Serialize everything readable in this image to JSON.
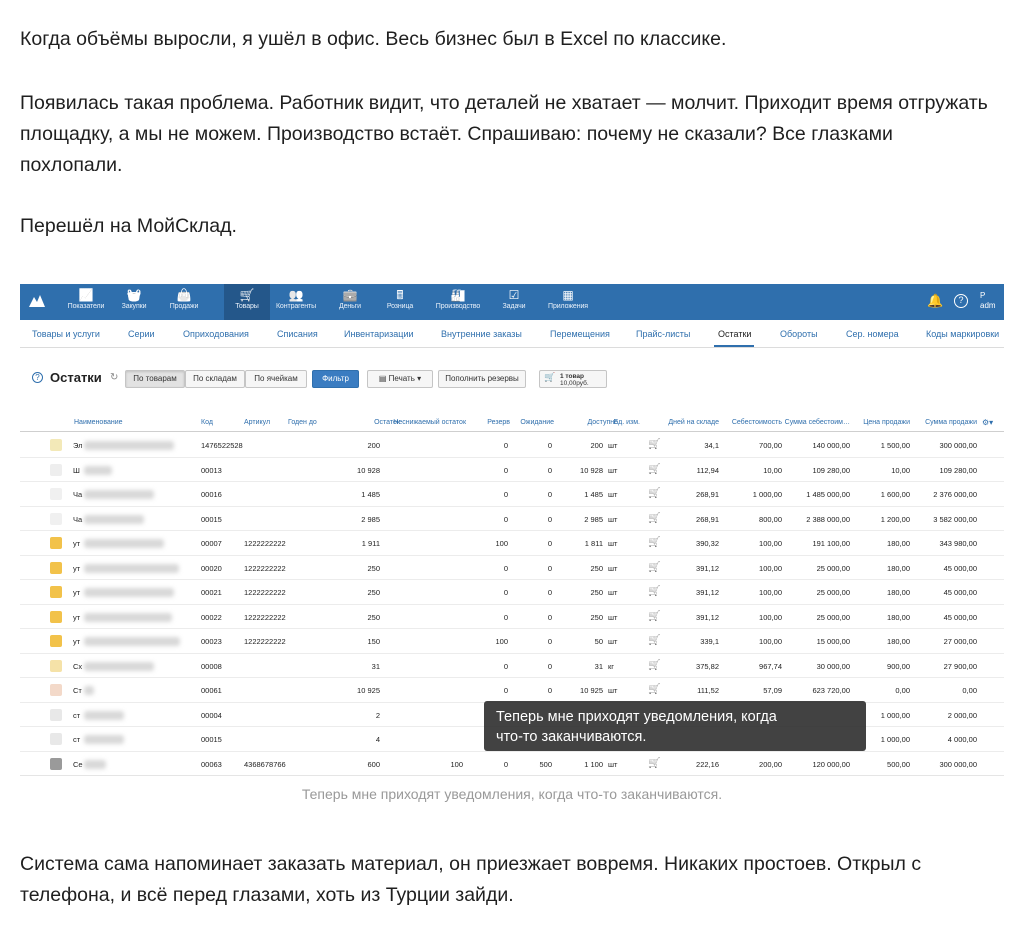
{
  "article": {
    "p1": "Когда объёмы выросли, я ушёл в офис. Весь бизнес был в Excel по классике.",
    "p2": "Появилась такая проблема. Работник видит, что деталей не хватает — молчит. Приходит время отгружать площадку, а мы не можем. Производство встаёт. Спрашиваю: почему не сказали? Все глазками похлопали.",
    "p3": "Перешёл на МойСклад.",
    "p4": "Система сама напоминает заказать материал, он приезжает вовремя. Никаких простоев. Открыл с телефона, и всё перед глазами, хоть из Турции зайди.",
    "caption": "Теперь мне приходят уведомления, когда что-то заканчиваются.",
    "tooltip_line1": "Теперь мне приходят уведомления, когда",
    "tooltip_line2": "что-то заканчиваются."
  },
  "app": {
    "brand_color": "#2f6fad",
    "nav": [
      {
        "label": "Показатели",
        "icon": "chart-icon"
      },
      {
        "label": "Закупки",
        "icon": "basket-icon"
      },
      {
        "label": "Продажи",
        "icon": "bag-icon"
      },
      {
        "label": "Товары",
        "icon": "cart-icon",
        "active": true
      },
      {
        "label": "Контрагенты",
        "icon": "people-icon"
      },
      {
        "label": "Деньги",
        "icon": "wallet-icon"
      },
      {
        "label": "Розница",
        "icon": "register-icon"
      },
      {
        "label": "Производство",
        "icon": "factory-icon"
      },
      {
        "label": "Задачи",
        "icon": "checkbox-icon"
      },
      {
        "label": "Приложения",
        "icon": "apps-icon"
      }
    ],
    "user_short": "P",
    "user_sub": "adm",
    "subnav": [
      "Товары и услуги",
      "Серии",
      "Оприходования",
      "Списания",
      "Инвентаризации",
      "Внутренние заказы",
      "Перемещения",
      "Прайс-листы",
      "Остатки",
      "Обороты",
      "Сер. номера",
      "Коды маркировки"
    ],
    "subnav_active": "Остатки",
    "page_title": "Остатки",
    "view_buttons": [
      "По товарам",
      "По складам",
      "По ячейкам"
    ],
    "filter_label": "Фильтр",
    "print_label": "Печать",
    "replenish_label": "Пополнить резервы",
    "cart_summary_line1": "1 товар",
    "cart_summary_line2": "10,00руб.",
    "columns": [
      "Наименование",
      "Код",
      "Артикул",
      "Годен до",
      "Остаток",
      "Неснижаемый остаток",
      "Резерв",
      "Ожидание",
      "Доступно",
      "Ед. изм.",
      "Дней на складе",
      "Себестоимость",
      "Сумма себестоим…",
      "Цена продажи",
      "Сумма продажи"
    ],
    "rows": [
      {
        "name": "Эл",
        "code": "1476522528",
        "article": "",
        "stock": "200",
        "min": "",
        "reserve": "0",
        "wait": "0",
        "avail": "200",
        "unit": "шт",
        "days": "34,1",
        "cost": "700,00",
        "cost_sum": "140 000,00",
        "price": "1 500,00",
        "sum": "300 000,00",
        "thumb": "#f3e9b8"
      },
      {
        "name": "Ш",
        "code": "00013",
        "article": "",
        "stock": "10 928",
        "min": "",
        "reserve": "0",
        "wait": "0",
        "avail": "10 928",
        "unit": "шт",
        "days": "112,94",
        "cost": "10,00",
        "cost_sum": "109 280,00",
        "price": "10,00",
        "sum": "109 280,00",
        "thumb": "#eeeeee"
      },
      {
        "name": "Ча",
        "code": "00016",
        "article": "",
        "stock": "1 485",
        "min": "",
        "reserve": "0",
        "wait": "0",
        "avail": "1 485",
        "unit": "шт",
        "days": "268,91",
        "cost": "1 000,00",
        "cost_sum": "1 485 000,00",
        "price": "1 600,00",
        "sum": "2 376 000,00",
        "thumb": "#f0f0f0"
      },
      {
        "name": "Ча",
        "code": "00015",
        "article": "",
        "stock": "2 985",
        "min": "",
        "reserve": "0",
        "wait": "0",
        "avail": "2 985",
        "unit": "шт",
        "days": "268,91",
        "cost": "800,00",
        "cost_sum": "2 388 000,00",
        "price": "1 200,00",
        "sum": "3 582 000,00",
        "thumb": "#f0f0f0"
      },
      {
        "name": "ут",
        "code": "00007",
        "article": "1222222222",
        "stock": "1 911",
        "min": "",
        "reserve": "100",
        "wait": "0",
        "avail": "1 811",
        "unit": "шт",
        "days": "390,32",
        "cost": "100,00",
        "cost_sum": "191 100,00",
        "price": "180,00",
        "sum": "343 980,00",
        "thumb": "#f2c24a"
      },
      {
        "name": "ут",
        "code": "00020",
        "article": "1222222222",
        "stock": "250",
        "min": "",
        "reserve": "0",
        "wait": "0",
        "avail": "250",
        "unit": "шт",
        "days": "391,12",
        "cost": "100,00",
        "cost_sum": "25 000,00",
        "price": "180,00",
        "sum": "45 000,00",
        "thumb": "#f2c24a"
      },
      {
        "name": "ут",
        "code": "00021",
        "article": "1222222222",
        "stock": "250",
        "min": "",
        "reserve": "0",
        "wait": "0",
        "avail": "250",
        "unit": "шт",
        "days": "391,12",
        "cost": "100,00",
        "cost_sum": "25 000,00",
        "price": "180,00",
        "sum": "45 000,00",
        "thumb": "#f2c24a"
      },
      {
        "name": "ут",
        "code": "00022",
        "article": "1222222222",
        "stock": "250",
        "min": "",
        "reserve": "0",
        "wait": "0",
        "avail": "250",
        "unit": "шт",
        "days": "391,12",
        "cost": "100,00",
        "cost_sum": "25 000,00",
        "price": "180,00",
        "sum": "45 000,00",
        "thumb": "#f2c24a"
      },
      {
        "name": "ут",
        "code": "00023",
        "article": "1222222222",
        "stock": "150",
        "min": "",
        "reserve": "100",
        "wait": "0",
        "avail": "50",
        "unit": "шт",
        "days": "339,1",
        "cost": "100,00",
        "cost_sum": "15 000,00",
        "price": "180,00",
        "sum": "27 000,00",
        "thumb": "#f2c24a"
      },
      {
        "name": "Сх",
        "code": "00008",
        "article": "",
        "stock": "31",
        "min": "",
        "reserve": "0",
        "wait": "0",
        "avail": "31",
        "unit": "кг",
        "days": "375,82",
        "cost": "967,74",
        "cost_sum": "30 000,00",
        "price": "900,00",
        "sum": "27 900,00",
        "thumb": "#f5e2a8"
      },
      {
        "name": "Ст",
        "code": "00061",
        "article": "",
        "stock": "10 925",
        "min": "",
        "reserve": "0",
        "wait": "0",
        "avail": "10 925",
        "unit": "шт",
        "days": "111,52",
        "cost": "57,09",
        "cost_sum": "623 720,00",
        "price": "0,00",
        "sum": "0,00",
        "thumb": "#f3d9c9"
      },
      {
        "name": "ст",
        "code": "00004",
        "article": "",
        "stock": "2",
        "min": "",
        "reserve": "",
        "wait": "",
        "avail": "",
        "unit": "",
        "days": "",
        "cost": "",
        "cost_sum": "",
        "price": "1 000,00",
        "sum": "2 000,00",
        "thumb": "#e8e8e8"
      },
      {
        "name": "ст",
        "code": "00015",
        "article": "",
        "stock": "4",
        "min": "",
        "reserve": "",
        "wait": "",
        "avail": "",
        "unit": "",
        "days": "",
        "cost": "",
        "cost_sum": "",
        "price": "1 000,00",
        "sum": "4 000,00",
        "thumb": "#e8e8e8"
      },
      {
        "name": "Се",
        "code": "00063",
        "article": "4368678766",
        "stock": "600",
        "min": "100",
        "reserve": "0",
        "wait": "500",
        "avail": "1 100",
        "unit": "шт",
        "days": "222,16",
        "cost": "200,00",
        "cost_sum": "120 000,00",
        "price": "500,00",
        "sum": "300 000,00",
        "thumb": "#9a9a9a"
      }
    ]
  }
}
